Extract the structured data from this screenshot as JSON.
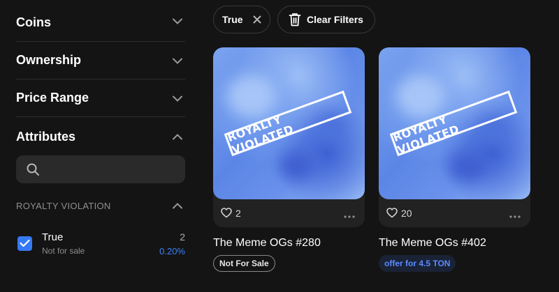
{
  "sidebar": {
    "sections": [
      {
        "label": "Coins",
        "state": "collapsed"
      },
      {
        "label": "Ownership",
        "state": "collapsed"
      },
      {
        "label": "Price Range",
        "state": "collapsed"
      },
      {
        "label": "Attributes",
        "state": "expanded"
      }
    ],
    "search": {
      "placeholder": "",
      "value": "",
      "icon": "search-icon"
    },
    "group": {
      "label": "ROYALTY VIOLATION",
      "state": "expanded"
    },
    "attribute": {
      "name": "True",
      "sub": "Not for sale",
      "count": "2",
      "percent": "0.20%",
      "checked": true
    }
  },
  "filters": {
    "active_chip": "True",
    "clear_label": "Clear Filters"
  },
  "cards": [
    {
      "stamp": "ROYALTY VIOLATED",
      "likes": "2",
      "title": "The Meme OGs #280",
      "badge": "Not For Sale"
    },
    {
      "stamp": "ROYALTY VIOLATED",
      "likes": "20",
      "title": "The Meme OGs #402",
      "offer_prefix": "offer for",
      "offer_amount": "4.5 TON"
    }
  ],
  "colors": {
    "background": "#141414",
    "accent": "#3479f6",
    "card": "#222222"
  }
}
